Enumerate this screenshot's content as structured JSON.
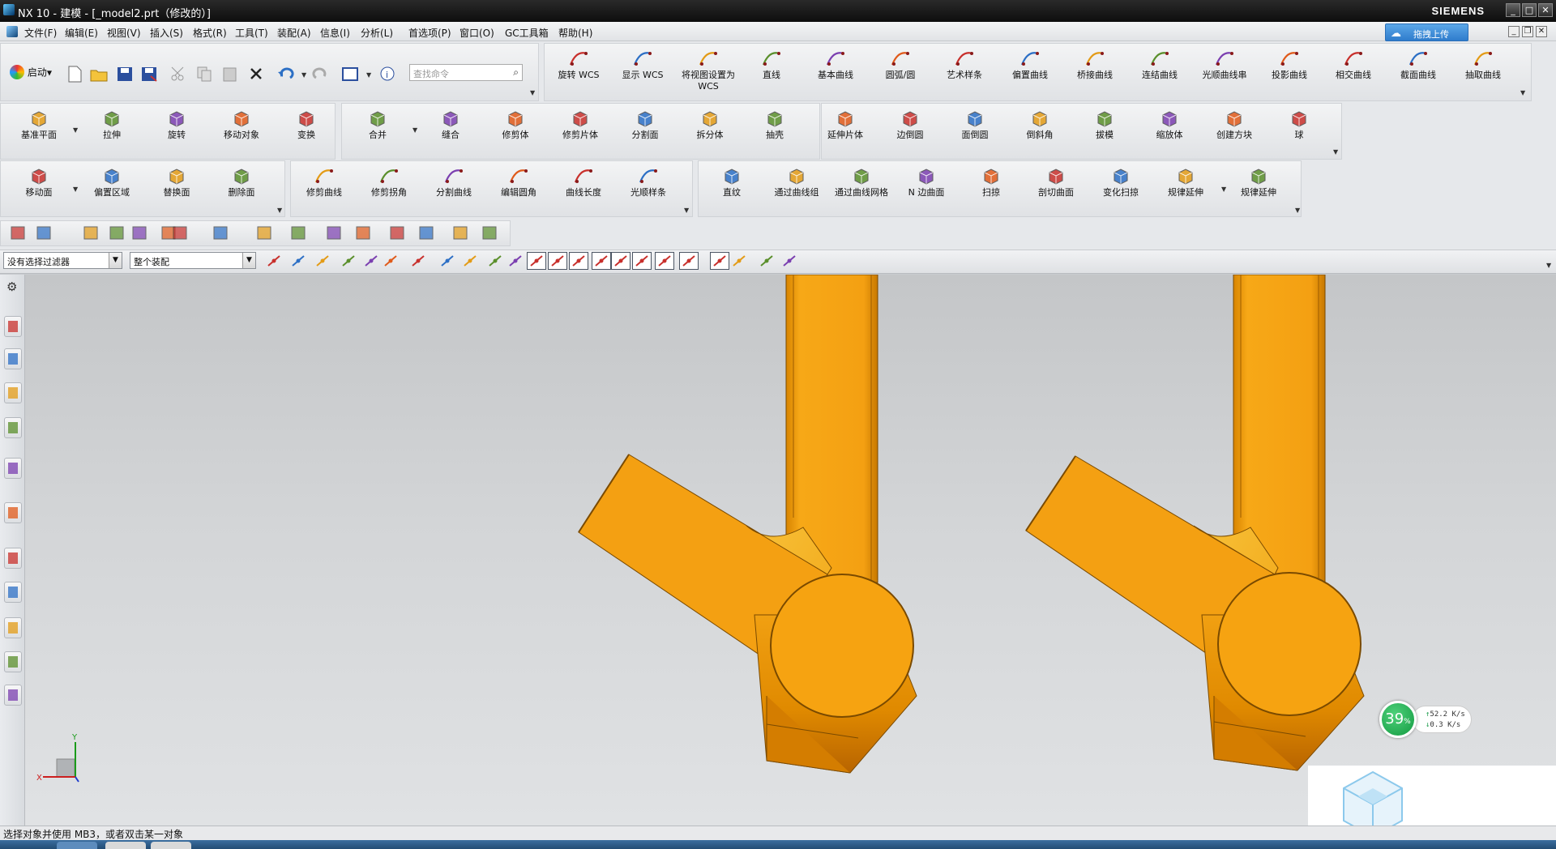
{
  "window": {
    "title": "NX 10 - 建模 - [_model2.prt（修改的）]",
    "brand": "SIEMENS"
  },
  "menu": [
    "文件(F)",
    "编辑(E)",
    "视图(V)",
    "插入(S)",
    "格式(R)",
    "工具(T)",
    "装配(A)",
    "信息(I)",
    "分析(L)",
    "首选项(P)",
    "窗口(O)",
    "GC工具箱",
    "帮助(H)"
  ],
  "upload_button": "拖拽上传",
  "quick": {
    "start": "启动",
    "search_placeholder": "查找命令"
  },
  "row1_tools": [
    "旋转 WCS",
    "显示 WCS",
    "将视图设置为 WCS",
    "直线",
    "基本曲线",
    "圆弧/圆",
    "艺术样条",
    "偏置曲线",
    "桥接曲线",
    "连结曲线",
    "光顺曲线串",
    "投影曲线",
    "相交曲线",
    "截面曲线",
    "抽取曲线"
  ],
  "row2_left": [
    "基准平面",
    "拉伸",
    "旋转",
    "移动对象",
    "变换"
  ],
  "row2_mid": [
    "合并",
    "缝合",
    "修剪体",
    "修剪片体",
    "分割面",
    "拆分体",
    "抽壳"
  ],
  "row2_right": [
    "延伸片体",
    "边倒圆",
    "面倒圆",
    "倒斜角",
    "拔模",
    "缩放体",
    "创建方块",
    "球"
  ],
  "row3_left": [
    "移动面",
    "偏置区域",
    "替换面",
    "删除面"
  ],
  "row3_mid": [
    "修剪曲线",
    "修剪拐角",
    "分割曲线",
    "编辑圆角",
    "曲线长度",
    "光顺样条"
  ],
  "row3_right": [
    "直纹",
    "通过曲线组",
    "通过曲线网格",
    "N 边曲面",
    "扫掠",
    "剖切曲面",
    "变化扫掠",
    "规律延伸",
    "规律延伸"
  ],
  "selection": {
    "filter": "没有选择过滤器",
    "scope": "整个装配"
  },
  "status_text": "选择对象并使用 MB3，或者双击某一对象",
  "network": {
    "percent": "39",
    "unit": "%",
    "up": "52.2 K/s",
    "down": "0.3 K/s"
  },
  "axis": {
    "x": "X",
    "y": "Y"
  },
  "colors": {
    "part": "#f4a012",
    "part_edge": "#7a4a00",
    "viewport_top": "#c4c6c8"
  }
}
